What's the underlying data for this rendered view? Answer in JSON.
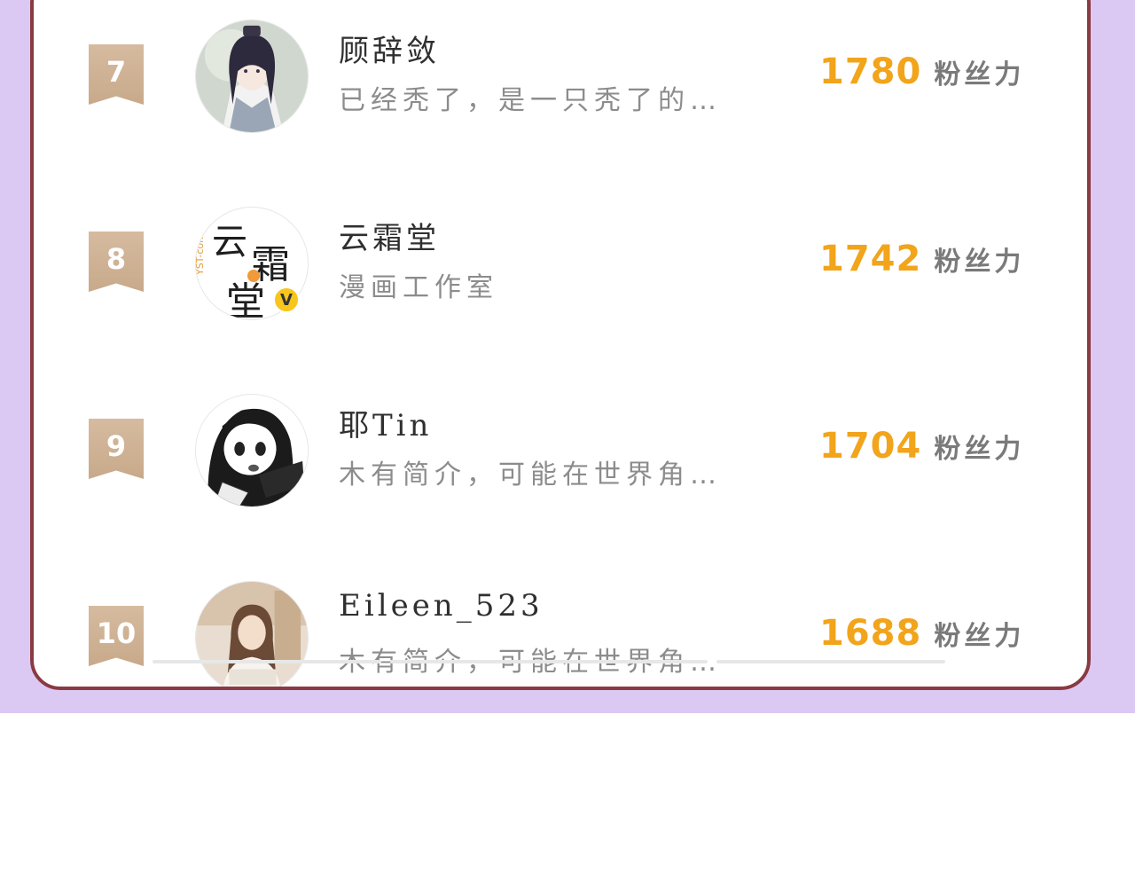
{
  "ranking": {
    "items": [
      {
        "rank": "7",
        "name": "顾辞敛",
        "bio": "已经秃了，是一只秃了的…",
        "score": "1780",
        "unit": "粉丝力",
        "verified": false
      },
      {
        "rank": "8",
        "name": "云霜堂",
        "bio": "漫画工作室",
        "score": "1742",
        "unit": "粉丝力",
        "verified": true
      },
      {
        "rank": "9",
        "name": "耶Tin",
        "bio": "木有简介，可能在世界角…",
        "score": "1704",
        "unit": "粉丝力",
        "verified": false
      },
      {
        "rank": "10",
        "name": "Eileen_523",
        "bio": "木有简介，可能在世界角…",
        "score": "1688",
        "unit": "粉丝力",
        "verified": false
      }
    ],
    "avatar2_text": {
      "top": "云",
      "mid": "霜",
      "bottom": "堂",
      "side": "YST-comic"
    },
    "verified_badge": "V"
  },
  "colors": {
    "background": "#dcc9f3",
    "card_border": "#8a3a43",
    "rank_ribbon": "#d0b294",
    "score": "#f2a41b"
  },
  "icons": [
    "rank-ribbon",
    "verified-badge-icon"
  ]
}
